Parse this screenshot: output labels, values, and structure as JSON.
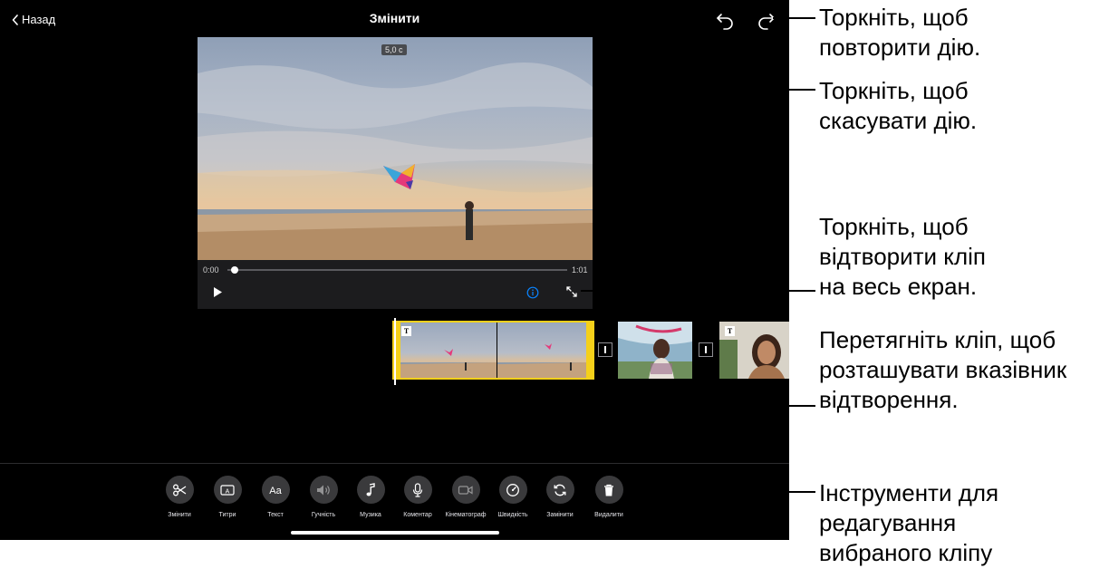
{
  "header": {
    "back_label": "Назад",
    "title": "Змінити"
  },
  "viewer": {
    "duration_badge": "5,0 с",
    "time_start": "0:00",
    "time_end": "1:01",
    "playhead_progress": 0.02
  },
  "toolbar": {
    "tools": [
      {
        "label": "Змінити",
        "icon": "scissors-icon"
      },
      {
        "label": "Титри",
        "icon": "titles-icon"
      },
      {
        "label": "Текст",
        "icon": "text-aa-icon"
      },
      {
        "label": "Гучність",
        "icon": "volume-icon"
      },
      {
        "label": "Музика",
        "icon": "music-note-icon"
      },
      {
        "label": "Коментар",
        "icon": "microphone-icon"
      },
      {
        "label": "Кінематограф",
        "icon": "cinematic-camera-icon"
      },
      {
        "label": "Швидкість",
        "icon": "speedometer-icon"
      },
      {
        "label": "Замінити",
        "icon": "replace-icon"
      },
      {
        "label": "Видалити",
        "icon": "trash-icon"
      }
    ]
  },
  "callouts": {
    "redo": "Торкніть, щоб\nповторити дію.",
    "undo": "Торкніть, щоб\nскасувати дію.",
    "fullscreen": "Торкніть, щоб\nвідтворити кліп\nна весь екран.",
    "playhead": "Перетягніть кліп, щоб\nрозташувати вказівник\nвідтворення.",
    "tools": "Інструменти для\nредагування\nвибраного кліпу"
  },
  "colors": {
    "screen_bg": "#000000",
    "selection_yellow": "#f5d01a",
    "info_accent": "#0a84ff",
    "tool_circle": "#3a3a3c"
  }
}
